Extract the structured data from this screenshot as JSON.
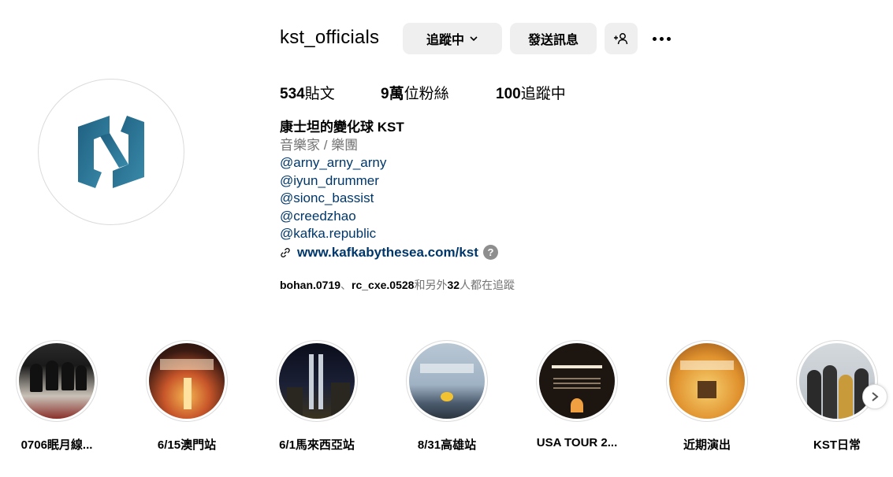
{
  "profile": {
    "username": "kst_officials",
    "buttons": {
      "following": "追蹤中",
      "message": "發送訊息"
    },
    "stats": {
      "posts_count": "534",
      "posts_label": "貼文",
      "followers_count": "9萬",
      "followers_label": "位粉絲",
      "following_count": "100",
      "following_label": "追蹤中"
    },
    "bio": {
      "name": "康士坦的變化球 KST",
      "category": "音樂家 / 樂團",
      "mentions": [
        "@arny_arny_arny",
        "@iyun_drummer",
        "@sionc_bassist",
        "@creedzhao",
        "@kafka.republic"
      ],
      "link": "www.kafkabythesea.com/kst",
      "help": "?"
    },
    "followed_by": {
      "user1": "bohan.0719",
      "sep": "、",
      "user2": "rc_cxe.0528",
      "pre": "和另外",
      "count": "32",
      "post": "人都在追蹤"
    }
  },
  "highlights": [
    {
      "label": "0706眠月線..."
    },
    {
      "label": "6/15澳門站"
    },
    {
      "label": "6/1馬來西亞站"
    },
    {
      "label": "8/31高雄站"
    },
    {
      "label": "USA TOUR 2..."
    },
    {
      "label": "近期演出"
    },
    {
      "label": "KST日常"
    }
  ],
  "colors": {
    "accent_link": "#00376b",
    "button_bg": "#efefef",
    "logo_teal": "#2b6f8f"
  }
}
